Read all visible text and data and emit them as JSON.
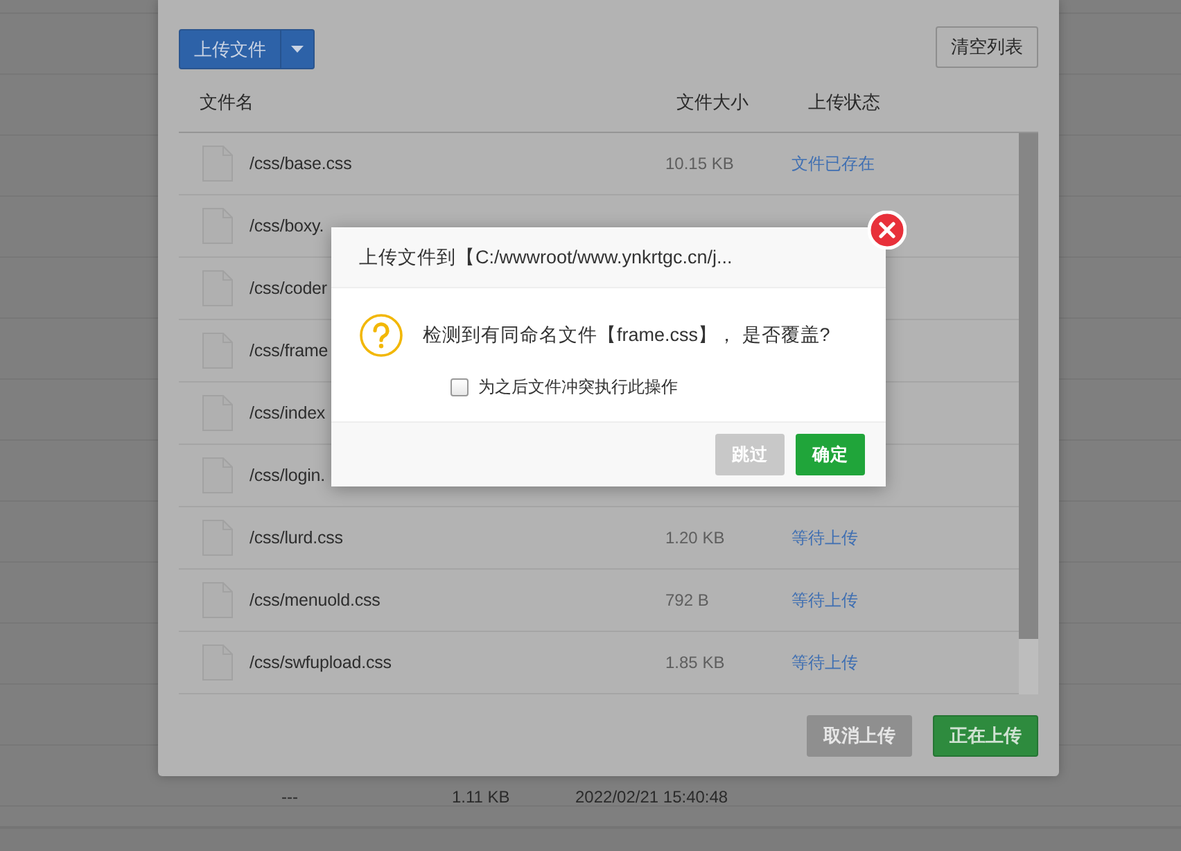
{
  "background_table": {
    "rows": [
      {
        "column_1": "---",
        "column_2": "1.11 KB",
        "column_3": "2022/02/21 15:40:48"
      }
    ]
  },
  "upload_panel": {
    "upload_button": "上传文件",
    "clear_button": "清空列表",
    "columns": [
      "文件名",
      "文件大小",
      "上传状态"
    ],
    "files": [
      {
        "name": "/css/base.css",
        "size": "10.15 KB",
        "status": "文件已存在"
      },
      {
        "name": "/css/boxy."
      },
      {
        "name": "/css/coder"
      },
      {
        "name": "/css/frame"
      },
      {
        "name": "/css/index"
      },
      {
        "name": "/css/login."
      },
      {
        "name": "/css/lurd.css",
        "size": "1.20 KB",
        "status": "等待上传"
      },
      {
        "name": "/css/menuold.css",
        "size": "792 B",
        "status": "等待上传"
      },
      {
        "name": "/css/swfupload.css",
        "size": "1.85 KB",
        "status": "等待上传"
      }
    ],
    "cancel_button": {
      "label": "取消上传",
      "disabled": true
    },
    "start_button": {
      "label": "正在上传",
      "disabled": false
    }
  },
  "dialog": {
    "title": "上传文件到【C:/wwwroot/www.ynkrtgc.cn/j...",
    "message": "检测到有同命名文件【frame.css】， 是否覆盖?",
    "checkbox": {
      "label": "为之后文件冲突执行此操作",
      "checked": false
    },
    "buttons": [
      {
        "label": "跳过",
        "kind": "secondary"
      },
      {
        "label": "确定",
        "kind": "primary"
      }
    ]
  }
}
